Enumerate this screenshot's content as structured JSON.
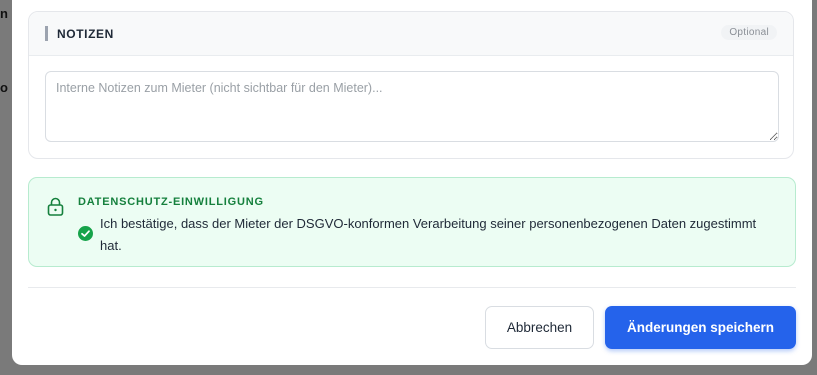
{
  "backdrop": {
    "fragment_1": "n",
    "fragment_2": "o"
  },
  "notes": {
    "title": "NOTIZEN",
    "badge": "Optional",
    "placeholder": "Interne Notizen zum Mieter (nicht sichtbar für den Mieter)..."
  },
  "consent": {
    "title": "DATENSCHUTZ-EINWILLIGUNG",
    "text": "Ich bestätige, dass der Mieter der DSGVO-konformen Verarbeitung seiner personenbezogenen Daten zugestimmt hat.",
    "icon": "lock-icon",
    "check_icon": "check-circle-icon"
  },
  "footer": {
    "cancel_label": "Abbrechen",
    "save_label": "Änderungen speichern"
  },
  "colors": {
    "accent": "#2563eb",
    "success": "#15803d",
    "success_bg": "#ecfdf3"
  }
}
